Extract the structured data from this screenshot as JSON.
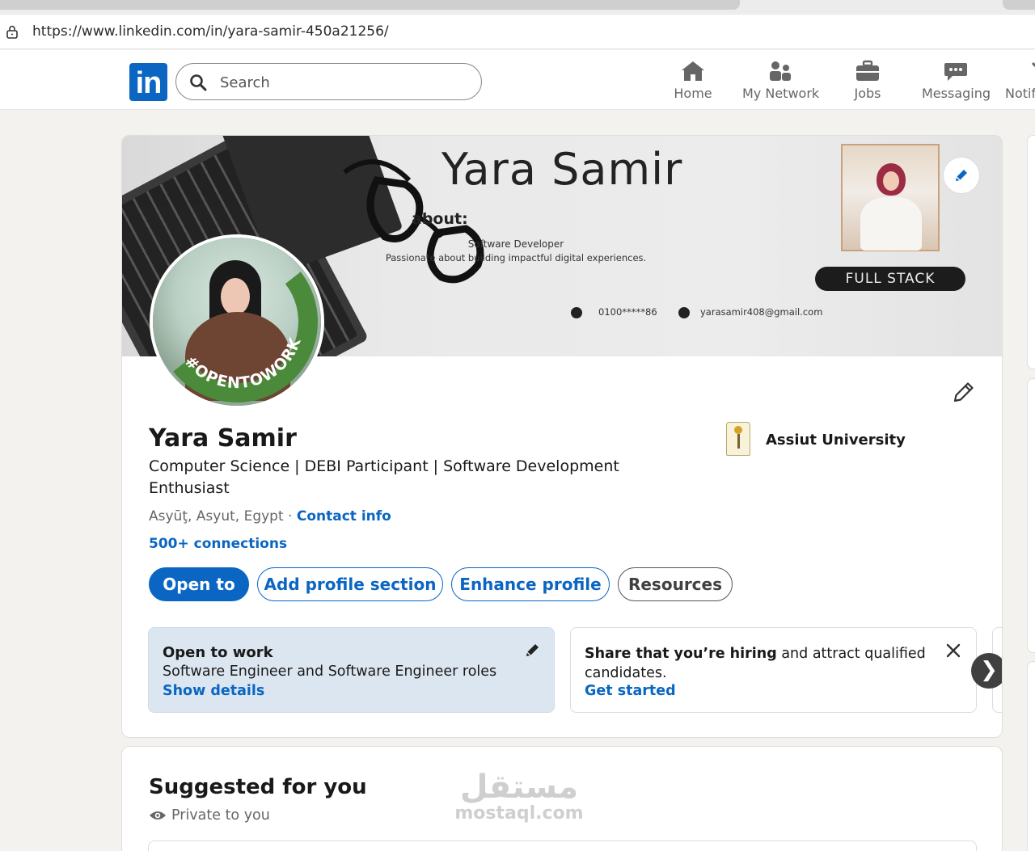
{
  "browser": {
    "url": "https://www.linkedin.com/in/yara-samir-450a21256/"
  },
  "nav": {
    "logo_text": "in",
    "search_placeholder": "Search",
    "items": [
      {
        "label": "Home",
        "icon": "home-icon"
      },
      {
        "label": "My Network",
        "icon": "network-icon"
      },
      {
        "label": "Jobs",
        "icon": "briefcase-icon"
      },
      {
        "label": "Messaging",
        "icon": "messaging-icon"
      },
      {
        "label": "Notif",
        "icon": "bell-icon"
      }
    ]
  },
  "banner": {
    "title": "Yara Samir",
    "about_label": "about:",
    "role": "Software Developer",
    "description": "Passionate about building impactful digital experiences.",
    "phone": "0100*****86",
    "email": "yarasamir408@gmail.com",
    "badge": "FULL STACK"
  },
  "avatar": {
    "frame_text": "#OPENTOWORK"
  },
  "profile": {
    "name": "Yara Samir",
    "headline": "Computer Science | DEBI Participant | Software Development Enthusiast",
    "location": "Asyūţ, Asyut, Egypt",
    "separator": "·",
    "contact_info": "Contact info",
    "connections": "500+ connections",
    "education": "Assiut University"
  },
  "actions": {
    "open_to": "Open to",
    "add_section": "Add profile section",
    "enhance": "Enhance profile",
    "resources": "Resources"
  },
  "open_to_work": {
    "title": "Open to work",
    "roles": "Software Engineer and Software Engineer roles",
    "link": "Show details"
  },
  "hiring": {
    "bold": "Share that you’re hiring",
    "rest": " and attract qualified candidates.",
    "link": "Get started"
  },
  "carousel": {
    "next_glyph": "❯"
  },
  "suggested": {
    "title": "Suggested for you",
    "privacy": "Private to you"
  },
  "watermark": {
    "arabic": "مستقل",
    "latin": "mostaql.com"
  },
  "colors": {
    "linkedin_blue": "#0a66c2",
    "opentowork_green": "#4a8a3a",
    "open_to_work_card": "#dce6f1"
  }
}
